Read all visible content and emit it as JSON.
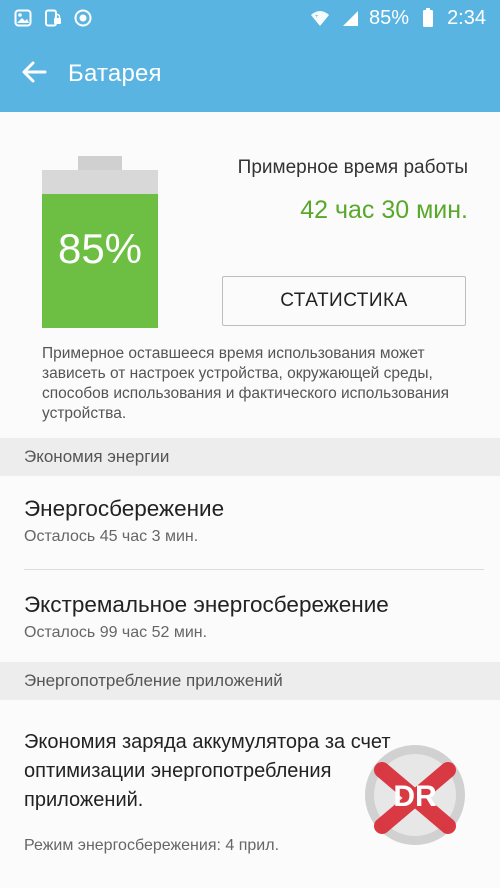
{
  "status_bar": {
    "battery_percent": "85%",
    "time": "2:34"
  },
  "app_bar": {
    "title": "Батарея"
  },
  "battery": {
    "level": 0.85,
    "percent_label": "85%",
    "fill_color": "#6cbf43"
  },
  "estimate": {
    "label": "Примерное время работы",
    "value": "42 час 30 мин."
  },
  "stats_button": {
    "label": "СТАТИСТИКА"
  },
  "disclaimer": "Примерное оставшееся время использования может зависеть от настроек устройства, окружающей среды, способов использования и фактического использования устройства.",
  "section_energy": {
    "header": "Экономия энергии",
    "items": [
      {
        "title": "Энергосбережение",
        "subtitle": "Осталось 45 час 3 мин."
      },
      {
        "title": "Экстремальное энергосбережение",
        "subtitle": "Осталось 99 час 52 мин."
      }
    ]
  },
  "section_apps": {
    "header": "Энергопотребление приложений",
    "title": "Экономия заряда аккумулятора за счет оптимизации энергопотребления приложений.",
    "subtitle": "Режим энергосбережения: 4 прил."
  },
  "watermark": {
    "text": "DR"
  },
  "colors": {
    "accent": "#5ab4e2",
    "estimate_green": "#5aa82b"
  }
}
